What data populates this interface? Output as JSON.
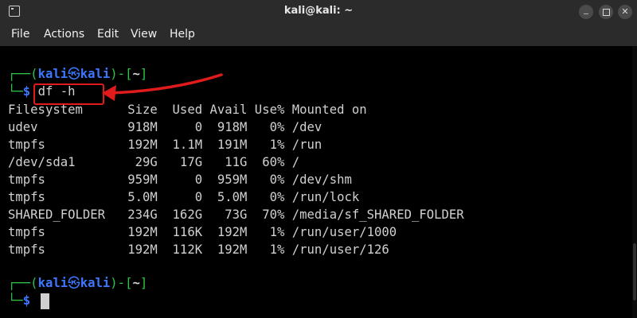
{
  "window": {
    "title": "kali@kali: ~",
    "minimize_symbol": "_",
    "close_symbol": "✕"
  },
  "menu": [
    "File",
    "Actions",
    "Edit",
    "View",
    "Help"
  ],
  "prompt": {
    "top_left": "┌──(",
    "user": "kali",
    "sep_symbol": "㉿",
    "host": "kali",
    "mid": ")-[",
    "dir": "~",
    "end": "]",
    "bottom_left": "└─",
    "dollar": "$"
  },
  "command": "df -h",
  "df_output": {
    "header": "Filesystem      Size  Used Avail Use% Mounted on",
    "rows": [
      "udev            918M     0  918M   0% /dev",
      "tmpfs           192M  1.1M  191M   1% /run",
      "/dev/sda1        29G   17G   11G  60% /",
      "tmpfs           959M     0  959M   0% /dev/shm",
      "tmpfs           5.0M     0  5.0M   0% /run/lock",
      "SHARED_FOLDER   234G  162G   73G  70% /media/sf_SHARED_FOLDER",
      "tmpfs           192M  116K  192M   1% /run/user/1000",
      "tmpfs           192M  112K  192M   1% /run/user/126"
    ]
  },
  "colors": {
    "prompt_blue": "#3b78ff",
    "prompt_green": "#2ec44a",
    "highlight_red": "#e01b1b",
    "text": "#d0d0d0",
    "background": "#000000"
  }
}
